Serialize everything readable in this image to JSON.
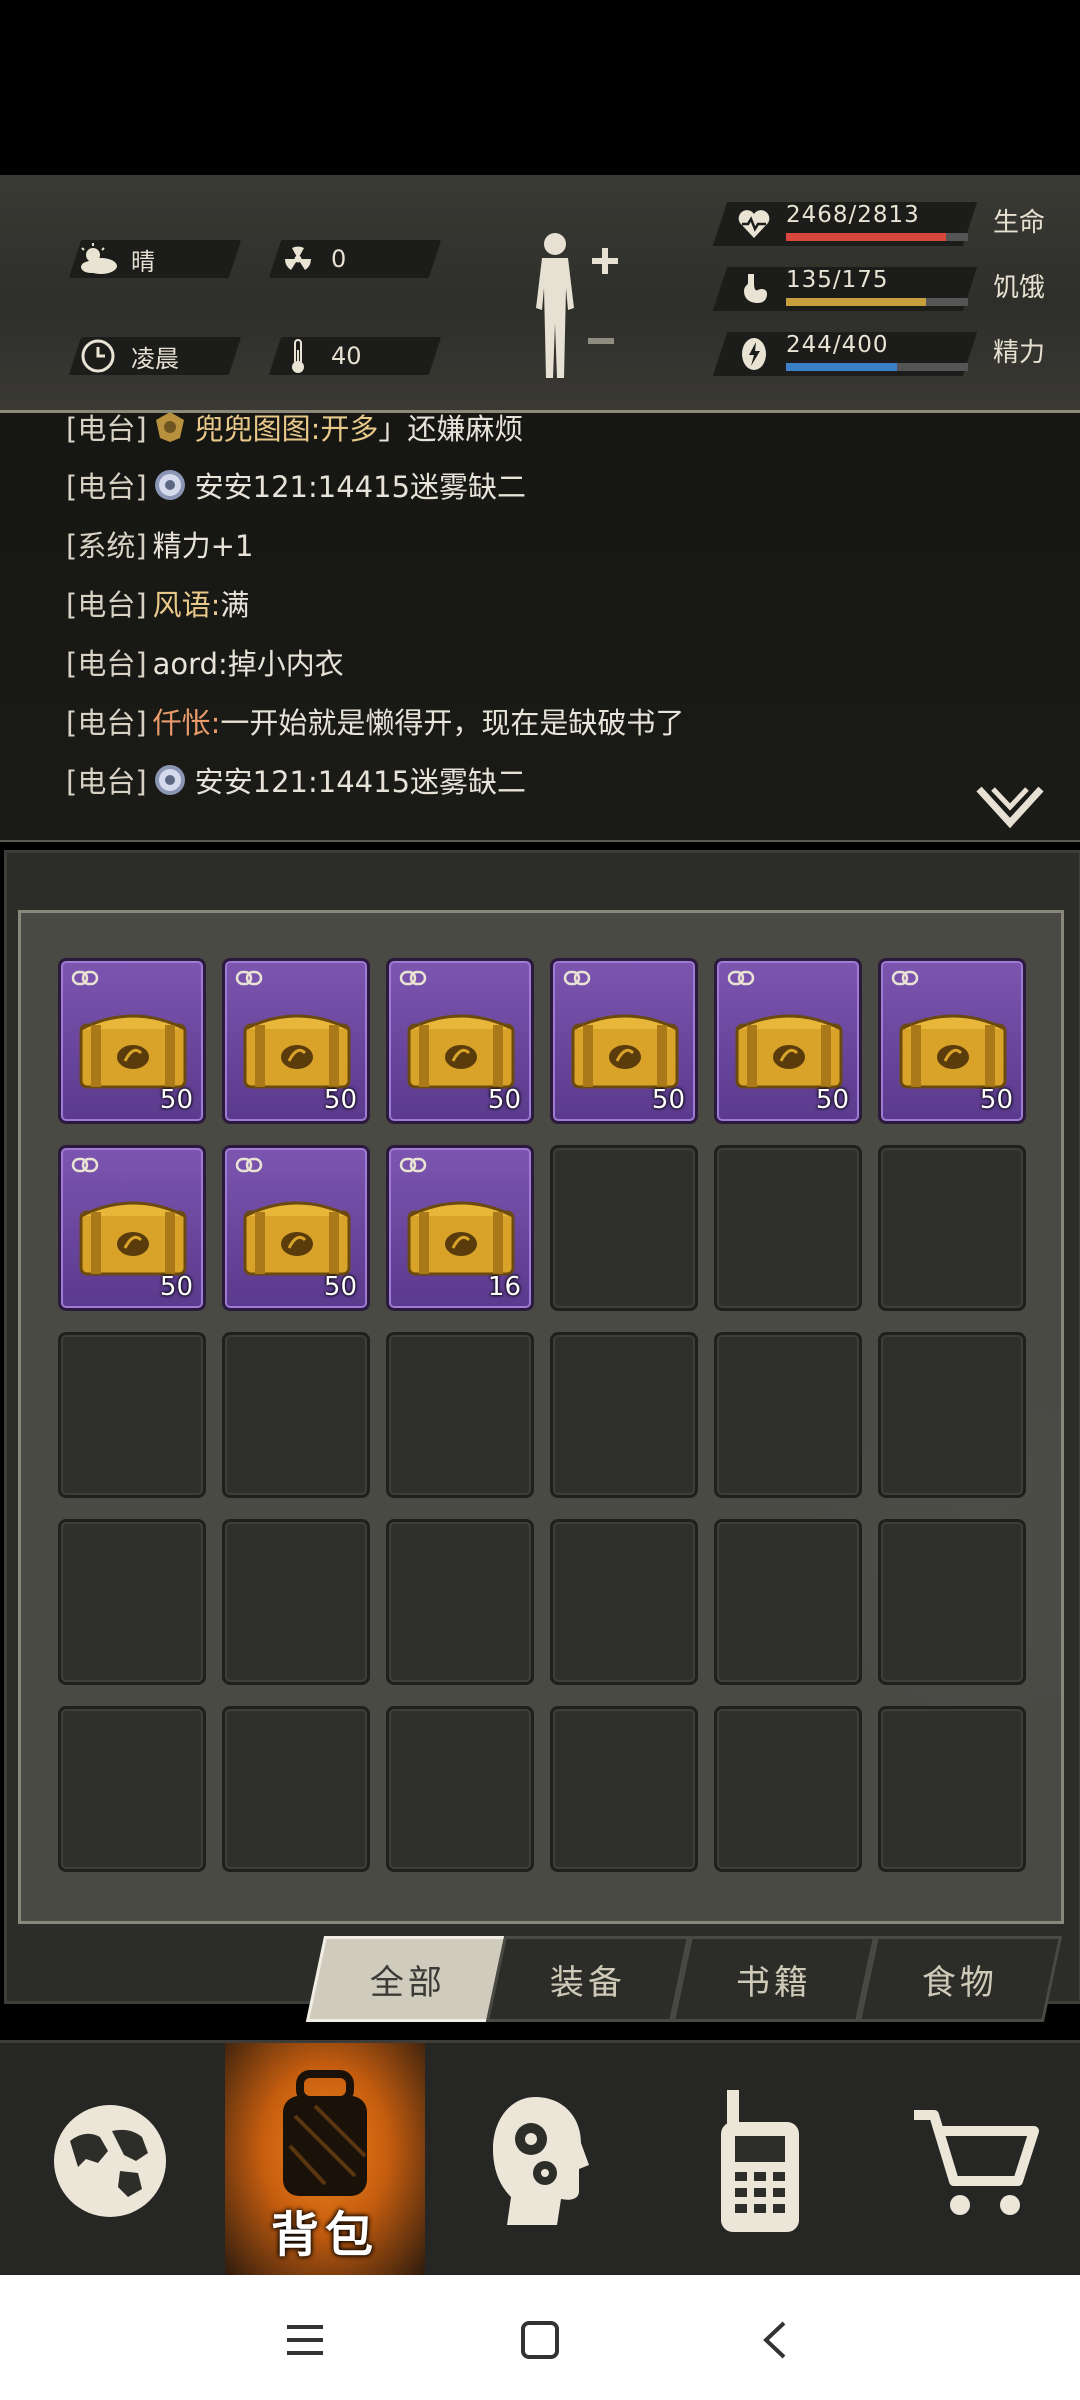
{
  "status": {
    "weather": {
      "icon": "cloud-sun-icon",
      "label": "晴"
    },
    "radiation": {
      "icon": "radiation-icon",
      "value": "0"
    },
    "time": {
      "icon": "clock-icon",
      "label": "凌晨"
    },
    "temperature": {
      "icon": "thermometer-icon",
      "value": "40"
    }
  },
  "stats": [
    {
      "icon": "heart-icon",
      "value": "2468/2813",
      "fraction": 0.877,
      "label": "生命",
      "color": "#d8463c"
    },
    {
      "icon": "stomach-icon",
      "value": "135/175",
      "fraction": 0.771,
      "label": "饥饿",
      "color": "#c7a03e"
    },
    {
      "icon": "energy-icon",
      "value": "244/400",
      "fraction": 0.61,
      "label": "精力",
      "color": "#3b7fc6"
    }
  ],
  "chat": [
    {
      "tag": "[电台]",
      "badge": false,
      "name": "兜兜图图:开多",
      "name_color": "gold",
      "msg": "」还嫌麻烦"
    },
    {
      "tag": "[电台]",
      "badge": true,
      "name": "",
      "name_color": "none",
      "msg": "安安121:14415迷雾缺二"
    },
    {
      "tag": "[系统]",
      "badge": false,
      "name": "",
      "name_color": "none",
      "msg": "精力+1"
    },
    {
      "tag": "[电台]",
      "badge": false,
      "name": "风语:",
      "name_color": "gold",
      "msg": "满"
    },
    {
      "tag": "[电台]",
      "badge": false,
      "name": "",
      "name_color": "none",
      "msg": "aord:掉小内衣"
    },
    {
      "tag": "[电台]",
      "badge": false,
      "name": "仟怅:",
      "name_color": "orange",
      "msg": "一开始就是懒得开，现在是缺破书了"
    },
    {
      "tag": "[电台]",
      "badge": true,
      "name": "",
      "name_color": "none",
      "msg": "安安121:14415迷雾缺二"
    }
  ],
  "inventory": {
    "slots": [
      {
        "item": "chest",
        "count": "50"
      },
      {
        "item": "chest",
        "count": "50"
      },
      {
        "item": "chest",
        "count": "50"
      },
      {
        "item": "chest",
        "count": "50"
      },
      {
        "item": "chest",
        "count": "50"
      },
      {
        "item": "chest",
        "count": "50"
      },
      {
        "item": "chest",
        "count": "50"
      },
      {
        "item": "chest",
        "count": "50"
      },
      {
        "item": "chest",
        "count": "16"
      },
      {
        "item": null
      },
      {
        "item": null
      },
      {
        "item": null
      },
      {
        "item": null
      },
      {
        "item": null
      },
      {
        "item": null
      },
      {
        "item": null
      },
      {
        "item": null
      },
      {
        "item": null
      },
      {
        "item": null
      },
      {
        "item": null
      },
      {
        "item": null
      },
      {
        "item": null
      },
      {
        "item": null
      },
      {
        "item": null
      },
      {
        "item": null
      },
      {
        "item": null
      },
      {
        "item": null
      },
      {
        "item": null
      },
      {
        "item": null
      },
      {
        "item": null
      }
    ],
    "tabs": [
      {
        "label": "全部",
        "active": true
      },
      {
        "label": "装备",
        "active": false
      },
      {
        "label": "书籍",
        "active": false
      },
      {
        "label": "食物",
        "active": false
      }
    ]
  },
  "bottom_nav": [
    {
      "icon": "globe-icon",
      "label": "",
      "active": false
    },
    {
      "icon": "backpack-icon",
      "label": "背包",
      "active": true
    },
    {
      "icon": "head-gears-icon",
      "label": "",
      "active": false
    },
    {
      "icon": "walkie-talkie-icon",
      "label": "",
      "active": false
    },
    {
      "icon": "cart-icon",
      "label": "",
      "active": false
    }
  ],
  "system_nav": [
    {
      "icon": "menu-icon"
    },
    {
      "icon": "home-icon"
    },
    {
      "icon": "back-icon"
    }
  ]
}
